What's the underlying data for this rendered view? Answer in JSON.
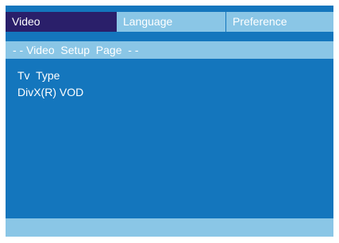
{
  "tabs": [
    {
      "label": "Video",
      "active": true
    },
    {
      "label": "Language",
      "active": false
    },
    {
      "label": "Preference",
      "active": false
    }
  ],
  "header": {
    "title": "- - Video  Setup  Page  - -"
  },
  "menu": {
    "items": [
      "Tv  Type",
      "DivX(R) VOD"
    ]
  },
  "footer": {
    "text": ""
  },
  "colors": {
    "background": "#1476bd",
    "active_tab": "#2a1f6a",
    "bar": "#8ac6e6",
    "text": "#ffffff"
  }
}
